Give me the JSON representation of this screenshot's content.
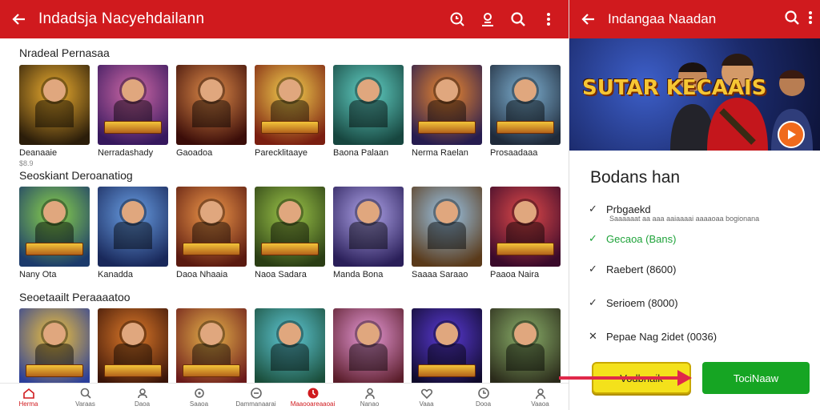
{
  "app": {
    "title": "Indadsja Nacyehdailann",
    "colors": {
      "primary": "#d01a1e",
      "cta_green": "#16a523",
      "cta_yellow": "#f4e11b"
    },
    "top_icons": [
      "timer-search-icon",
      "profile-icon",
      "search-icon",
      "more-vert-icon"
    ]
  },
  "sections": [
    {
      "title": "Nradeal Pernasaa",
      "tiles": [
        {
          "name": "Deanaaie",
          "sub": "$8.9",
          "badge": "",
          "c1": "#f0b030",
          "c2": "#2b1d0a"
        },
        {
          "name": "Nerradashady",
          "sub": "",
          "badge": "NIDRASHE",
          "c1": "#d26aa8",
          "c2": "#36185d"
        },
        {
          "name": "Gaoadoa",
          "sub": "",
          "badge": "",
          "c1": "#e28d4a",
          "c2": "#3b0d09"
        },
        {
          "name": "Parecklitaaye",
          "sub": "",
          "badge": "SOANIE",
          "c1": "#f6d450",
          "c2": "#7a1e10"
        },
        {
          "name": "Baona Palaan",
          "sub": "",
          "badge": "",
          "c1": "#63d3c8",
          "c2": "#17463f"
        },
        {
          "name": "Nerma Raelan",
          "sub": "",
          "badge": "SUPRIE",
          "c1": "#f08a2f",
          "c2": "#261c4f"
        },
        {
          "name": "Prosaadaaa",
          "sub": "",
          "badge": "PORAORE",
          "c1": "#7fb2d4",
          "c2": "#1f2a3a"
        }
      ]
    },
    {
      "title": "Seoskiant Deroanatiog",
      "tiles": [
        {
          "name": "Nany Ota",
          "sub": "",
          "badge": "VINEA",
          "c1": "#8dd64a",
          "c2": "#1b3a6b"
        },
        {
          "name": "Kanadda",
          "sub": "",
          "badge": "",
          "c1": "#6aa0e6",
          "c2": "#19285a"
        },
        {
          "name": "Daoa Nhaaia",
          "sub": "",
          "badge": "TIRDAREN",
          "c1": "#f2994a",
          "c2": "#5a1a10"
        },
        {
          "name": "Naoa Sadara",
          "sub": "",
          "badge": "PANARAY",
          "c1": "#9ec84a",
          "c2": "#2a3d14"
        },
        {
          "name": "Manda Bona",
          "sub": "",
          "badge": "",
          "c1": "#b1a6ec",
          "c2": "#2a1f59"
        },
        {
          "name": "Saaaa Saraao",
          "sub": "",
          "badge": "",
          "c1": "#9cc7ea",
          "c2": "#5a3a1a"
        },
        {
          "name": "Paaoa Naira",
          "sub": "",
          "badge": "PARASANE",
          "c1": "#e24a4a",
          "c2": "#3a0a2a"
        }
      ]
    },
    {
      "title": "Seoetaailt Peraaaatoo",
      "tiles": [
        {
          "name": "",
          "sub": "",
          "badge": "IBERARS",
          "c1": "#f3c43a",
          "c2": "#2b3f9a"
        },
        {
          "name": "",
          "sub": "",
          "badge": "NUARIA",
          "c1": "#e07b2a",
          "c2": "#3a1408"
        },
        {
          "name": "",
          "sub": "",
          "badge": "INAIDRE",
          "c1": "#e7b34a",
          "c2": "#6b1a1a"
        },
        {
          "name": "",
          "sub": "",
          "badge": "",
          "c1": "#5fc9d6",
          "c2": "#1a4d3a"
        },
        {
          "name": "",
          "sub": "",
          "badge": "",
          "c1": "#e89ad8",
          "c2": "#5a1d2a"
        },
        {
          "name": "",
          "sub": "",
          "badge": "NANDROR",
          "c1": "#5a3ad6",
          "c2": "#0f0a2a"
        },
        {
          "name": "",
          "sub": "",
          "badge": "",
          "c1": "#8bb06a",
          "c2": "#2a2a1a"
        }
      ]
    }
  ],
  "bottom_nav": [
    {
      "label": "Herma",
      "icon": "home-icon",
      "active": true
    },
    {
      "label": "Varaas",
      "icon": "search-icon",
      "active": false
    },
    {
      "label": "Daoa",
      "icon": "people-icon",
      "active": false
    },
    {
      "label": "Saaoa",
      "icon": "settings-icon",
      "active": false
    },
    {
      "label": "Dammanaarai",
      "icon": "chat-icon",
      "active": false
    },
    {
      "label": "Maaooareaaoai",
      "icon": "history-icon",
      "active": true
    },
    {
      "label": "Nanao",
      "icon": "user-icon",
      "active": false
    },
    {
      "label": "Vaaa",
      "icon": "heart-icon",
      "active": false
    },
    {
      "label": "Dooa",
      "icon": "clock-icon",
      "active": false
    },
    {
      "label": "Vaaoa",
      "icon": "account-icon",
      "active": false
    }
  ],
  "detail": {
    "title": "Indangaa Naadan",
    "banner_title": "SUTAR KECAAIS",
    "heading": "Bodans han",
    "items": [
      {
        "mark": "✓",
        "label": "Prbgaekd",
        "green": false
      },
      {
        "mark": "✓",
        "label": "Gecaoa (Bans)",
        "green": true
      },
      {
        "mark": "✓",
        "label": "Raebert (8600)",
        "green": false
      },
      {
        "mark": "✓",
        "label": "Serioem (8000)",
        "green": false
      },
      {
        "mark": "✕",
        "label": "Pepae Nag 2idet (0036)",
        "green": false
      }
    ],
    "item_sub": "Saaaaaat aa aaa aaiaaaai aaaaoaa bogionana",
    "btn_primary": "Vodbnaik",
    "btn_secondary": "TociNaaw"
  }
}
